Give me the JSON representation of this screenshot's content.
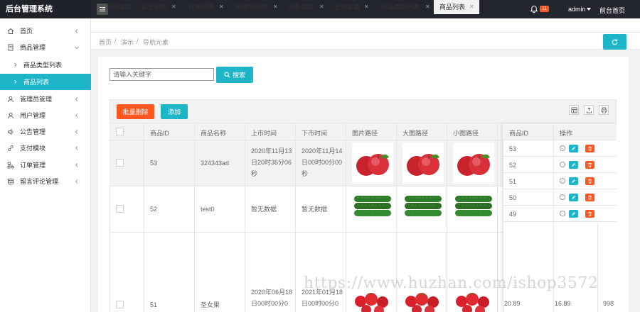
{
  "app": {
    "title": "后台管理系统",
    "notif_count": "11",
    "user": "admin",
    "front_link": "前台首页"
  },
  "sidebar": {
    "items": [
      {
        "label": "首页"
      },
      {
        "label": "商品管理"
      },
      {
        "label": "商品类型列表"
      },
      {
        "label": "商品列表"
      },
      {
        "label": "管理员管理"
      },
      {
        "label": "用户管理"
      },
      {
        "label": "公告管理"
      },
      {
        "label": "支付模块"
      },
      {
        "label": "订单管理"
      },
      {
        "label": "留言评论管理"
      }
    ]
  },
  "tabs": [
    {
      "label": "我的桌面"
    },
    {
      "label": "留言列表"
    },
    {
      "label": "订单列表"
    },
    {
      "label": "管理员列表"
    },
    {
      "label": "公告类型"
    },
    {
      "label": "我的桌面"
    },
    {
      "label": "商品类型列表"
    },
    {
      "label": "商品列表"
    }
  ],
  "breadcrumb": {
    "home": "首页",
    "sep1": "/",
    "demo": "演示",
    "sep2": "/",
    "current": "导航元素"
  },
  "search": {
    "placeholder": "请输入关键字",
    "button": "搜索"
  },
  "toolbar": {
    "batch_delete": "批量删除",
    "add": "添加"
  },
  "table": {
    "headers": [
      "商品ID",
      "商品名称",
      "上市时间",
      "下市时间",
      "图片路径",
      "大图路径",
      "小图路径",
      "商品ID",
      "操作"
    ],
    "rows": [
      {
        "id": "53",
        "name": "324343ad",
        "on": "2020年11月13日20时36分06秒",
        "off": "2020年11月14日00时00分00秒",
        "fruit": "apple"
      },
      {
        "id": "52",
        "name": "test0",
        "on": "暂无数据",
        "off": "暂无数据",
        "fruit": "cucumber"
      },
      {
        "id": "51",
        "name": "圣女果",
        "on": "2020年06月18日00时00分0",
        "off": "2021年01月18日00时00分0",
        "fruit": "tomato"
      }
    ],
    "fixed_ids": [
      "53",
      "52",
      "51",
      "50",
      "49"
    ],
    "bottom_vals": [
      "20.89",
      "16.89",
      "998"
    ]
  },
  "colors": {
    "accent": "#1fb5c9",
    "danger": "#ff5722",
    "topbar": "#23262e"
  },
  "watermark": "https://www.huzhan.com/ishop3572"
}
